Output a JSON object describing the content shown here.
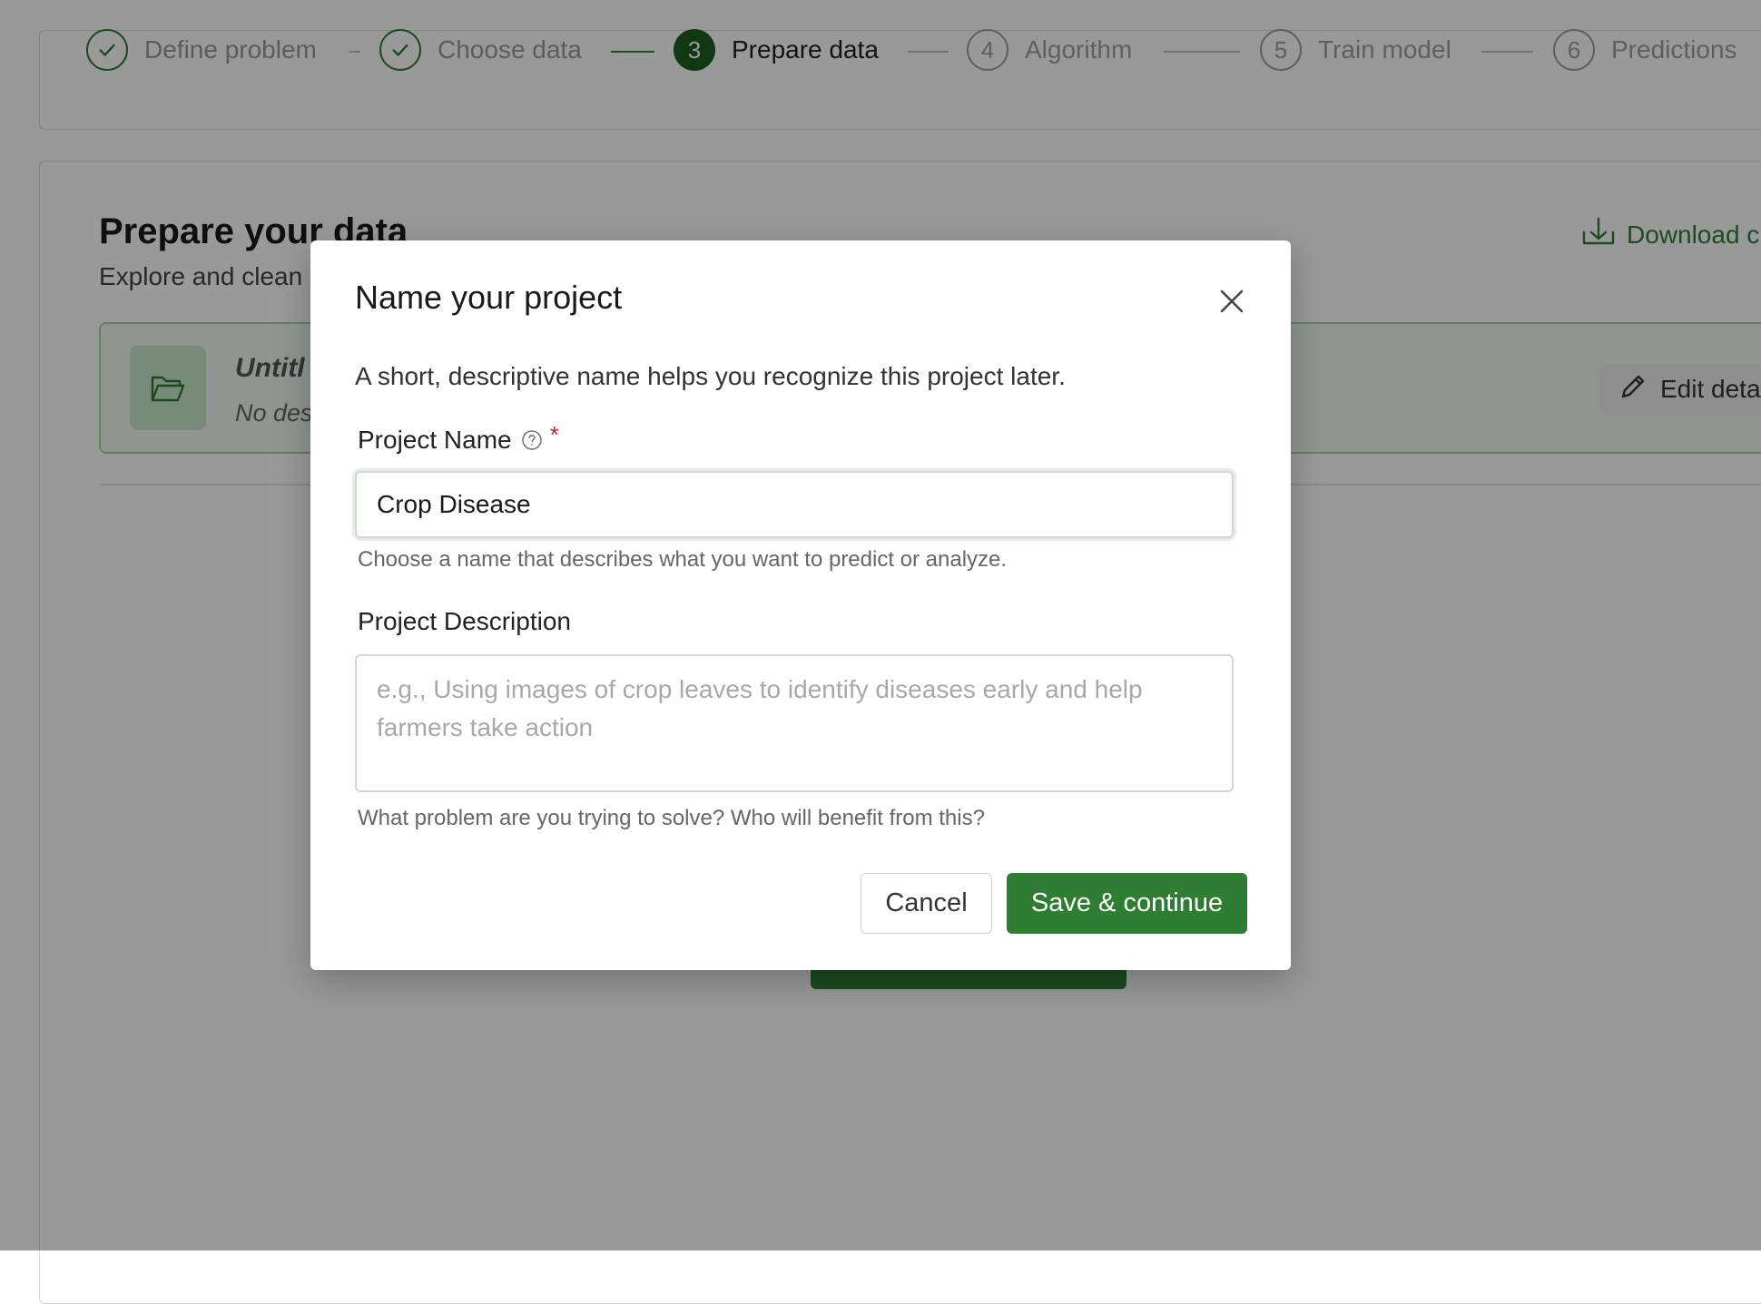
{
  "stepper": {
    "steps": [
      {
        "number": "",
        "label": "Define problem",
        "state": "done"
      },
      {
        "number": "",
        "label": "Choose data",
        "state": "done"
      },
      {
        "number": "3",
        "label": "Prepare data",
        "state": "active"
      },
      {
        "number": "4",
        "label": "Algorithm",
        "state": "pending"
      },
      {
        "number": "5",
        "label": "Train model",
        "state": "pending"
      },
      {
        "number": "6",
        "label": "Predictions",
        "state": "pending"
      }
    ]
  },
  "page": {
    "title": "Prepare your data",
    "subtitle": "Explore and clean",
    "download_label": "Download c",
    "banner_title": "Untitl",
    "banner_desc": "No des",
    "edit_label": "Edit deta"
  },
  "modal": {
    "title": "Name your project",
    "intro": "A short, descriptive name helps you recognize this project later.",
    "name_label": "Project Name",
    "required_mark": "*",
    "name_value": "Crop Disease",
    "name_help": "Choose a name that describes what you want to predict or analyze.",
    "description_label": "Project Description",
    "description_value": "",
    "description_placeholder": "e.g., Using images of crop leaves to identify diseases early and help farmers take action",
    "description_help": "What problem are you trying to solve? Who will benefit from this?",
    "cancel_label": "Cancel",
    "save_label": "Save & continue"
  },
  "colors": {
    "brand_green": "#2e7d32",
    "active_step": "#1b5e20",
    "required": "#c62828",
    "overlay": "rgba(0,0,0,0.40)"
  },
  "icons": {
    "close": "close-icon",
    "help": "help-circle-icon",
    "download": "download-icon",
    "folder": "folder-open-icon",
    "edit": "pencil-icon",
    "check": "check-icon"
  }
}
